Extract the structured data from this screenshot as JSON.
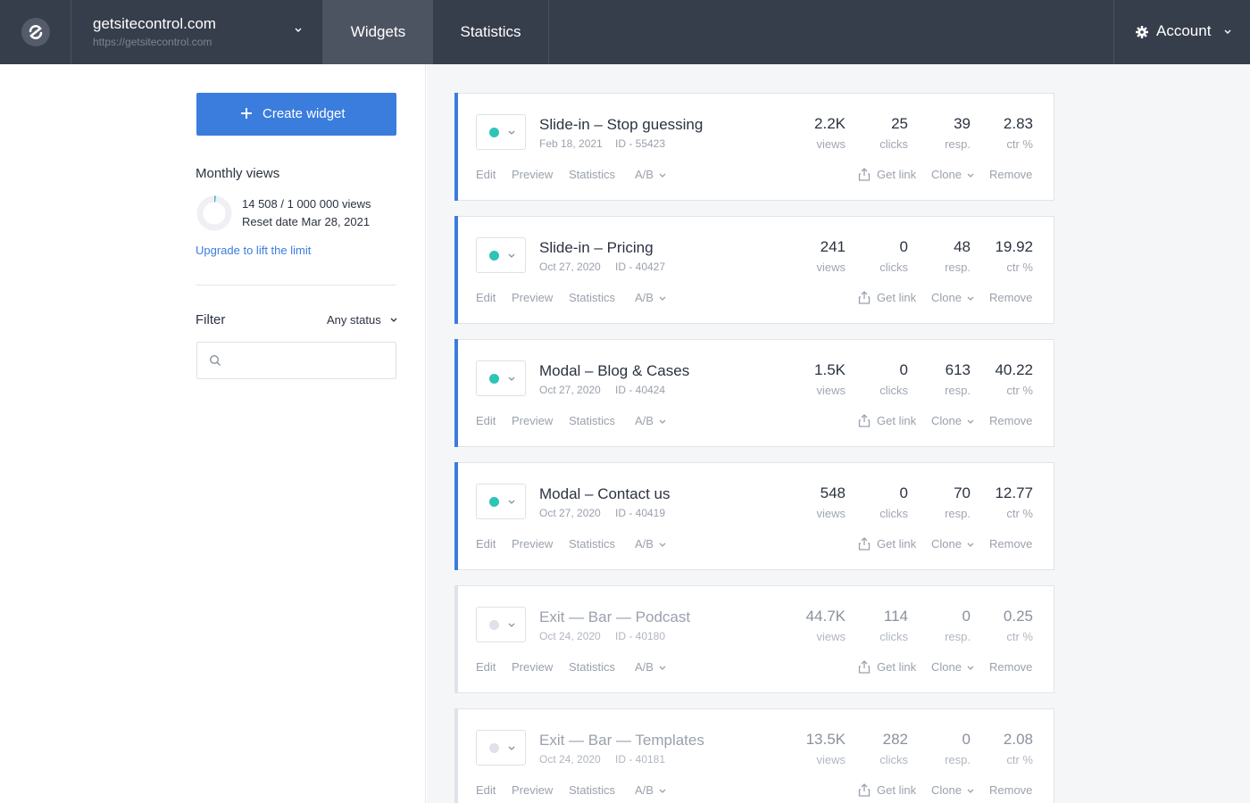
{
  "topbar": {
    "site_name": "getsitecontrol.com",
    "site_url": "https://getsitecontrol.com",
    "tabs": [
      {
        "label": "Widgets",
        "active": true
      },
      {
        "label": "Statistics",
        "active": false
      }
    ],
    "account_label": "Account"
  },
  "sidebar": {
    "create_button": "Create widget",
    "monthly_title": "Monthly views",
    "usage_text": "14 508 / 1 000 000 views",
    "reset_text": "Reset date Mar 28, 2021",
    "usage_fraction": 0.0145,
    "upgrade_link": "Upgrade to lift the limit",
    "filter_label": "Filter",
    "filter_status": "Any status",
    "search_value": ""
  },
  "actions": {
    "edit": "Edit",
    "preview": "Preview",
    "statistics": "Statistics",
    "ab": "A/B",
    "get_link": "Get link",
    "clone": "Clone",
    "remove": "Remove"
  },
  "stat_labels": {
    "views": "views",
    "clicks": "clicks",
    "resp": "resp.",
    "ctr": "ctr %"
  },
  "colors": {
    "accent": "#3b7ddd",
    "active_dot": "#2ec4b6",
    "topbar": "#363d4b"
  },
  "widgets": [
    {
      "title": "Slide-in – Stop guessing",
      "date": "Feb 18, 2021",
      "id": "ID - 55423",
      "views": "2.2K",
      "clicks": "25",
      "resp": "39",
      "ctr": "2.83",
      "active": true
    },
    {
      "title": "Slide-in – Pricing",
      "date": "Oct 27, 2020",
      "id": "ID - 40427",
      "views": "241",
      "clicks": "0",
      "resp": "48",
      "ctr": "19.92",
      "active": true
    },
    {
      "title": "Modal – Blog & Cases",
      "date": "Oct 27, 2020",
      "id": "ID - 40424",
      "views": "1.5K",
      "clicks": "0",
      "resp": "613",
      "ctr": "40.22",
      "active": true
    },
    {
      "title": "Modal – Contact us",
      "date": "Oct 27, 2020",
      "id": "ID - 40419",
      "views": "548",
      "clicks": "0",
      "resp": "70",
      "ctr": "12.77",
      "active": true
    },
    {
      "title": "Exit — Bar — Podcast",
      "date": "Oct 24, 2020",
      "id": "ID - 40180",
      "views": "44.7K",
      "clicks": "114",
      "resp": "0",
      "ctr": "0.25",
      "active": false
    },
    {
      "title": "Exit — Bar — Templates",
      "date": "Oct 24, 2020",
      "id": "ID - 40181",
      "views": "13.5K",
      "clicks": "282",
      "resp": "0",
      "ctr": "2.08",
      "active": false
    }
  ]
}
